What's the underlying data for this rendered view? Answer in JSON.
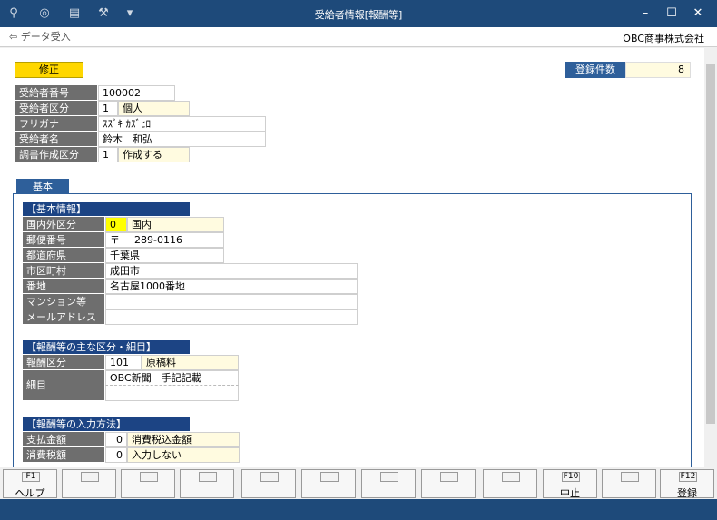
{
  "window": {
    "title": "受給者情報[報酬等]",
    "toolbar_icons": [
      "search-icon",
      "preview-icon",
      "print-icon",
      "tools-icon",
      "dropdown-icon"
    ],
    "controls": [
      "minimize-icon",
      "maximize-icon",
      "close-icon"
    ]
  },
  "toolbar": {
    "import_label": "データ受入",
    "company": "OBC商事株式会社"
  },
  "header": {
    "mode": "修正",
    "count_label": "登録件数",
    "count_value": "8",
    "fields": {
      "recipient_no": {
        "label": "受給者番号",
        "value": "100002"
      },
      "recipient_cat": {
        "label": "受給者区分",
        "code": "1",
        "value": "個人"
      },
      "furigana": {
        "label": "フリガナ",
        "value": "ｽｽﾞｷ ｶｽﾞﾋﾛ"
      },
      "name": {
        "label": "受給者名",
        "value": "鈴木　和弘"
      },
      "doc_create": {
        "label": "調書作成区分",
        "code": "1",
        "value": "作成する"
      }
    }
  },
  "tab": {
    "label": "基本"
  },
  "basic": {
    "heading": "【基本情報】",
    "domestic": {
      "label": "国内外区分",
      "code": "0",
      "value": "国内"
    },
    "postal": {
      "label": "郵便番号",
      "mark": "〒",
      "value": "289-0116"
    },
    "pref": {
      "label": "都道府県",
      "value": "千葉県"
    },
    "city": {
      "label": "市区町村",
      "value": "成田市"
    },
    "address": {
      "label": "番地",
      "value": "名古屋1000番地"
    },
    "building": {
      "label": "マンション等",
      "value": ""
    },
    "email": {
      "label": "メールアドレス",
      "value": ""
    }
  },
  "category": {
    "heading": "【報酬等の主な区分・細目】",
    "reward": {
      "label": "報酬区分",
      "code": "101",
      "value": "原稿料"
    },
    "detail": {
      "label": "細目",
      "line1": "OBC新聞　手記記載",
      "line2": ""
    }
  },
  "input_method": {
    "heading": "【報酬等の入力方法】",
    "payment": {
      "label": "支払金額",
      "code": "0",
      "value": "消費税込金額"
    },
    "tax": {
      "label": "消費税額",
      "code": "0",
      "value": "入力しない"
    }
  },
  "fkeys": [
    {
      "num": "F1",
      "label": "ヘルプ"
    },
    {
      "num": "",
      "label": ""
    },
    {
      "num": "",
      "label": ""
    },
    {
      "num": "",
      "label": ""
    },
    {
      "num": "",
      "label": ""
    },
    {
      "num": "",
      "label": ""
    },
    {
      "num": "",
      "label": ""
    },
    {
      "num": "",
      "label": ""
    },
    {
      "num": "",
      "label": ""
    },
    {
      "num": "F10",
      "label": "中止"
    },
    {
      "num": "",
      "label": ""
    },
    {
      "num": "F12",
      "label": "登録"
    }
  ],
  "colors": {
    "titlebar": "#1e4a7a",
    "label_bg": "#6e6e6e",
    "section_head": "#1c4484",
    "mode_badge": "#ffd700",
    "accent": "#2e5f9a"
  }
}
